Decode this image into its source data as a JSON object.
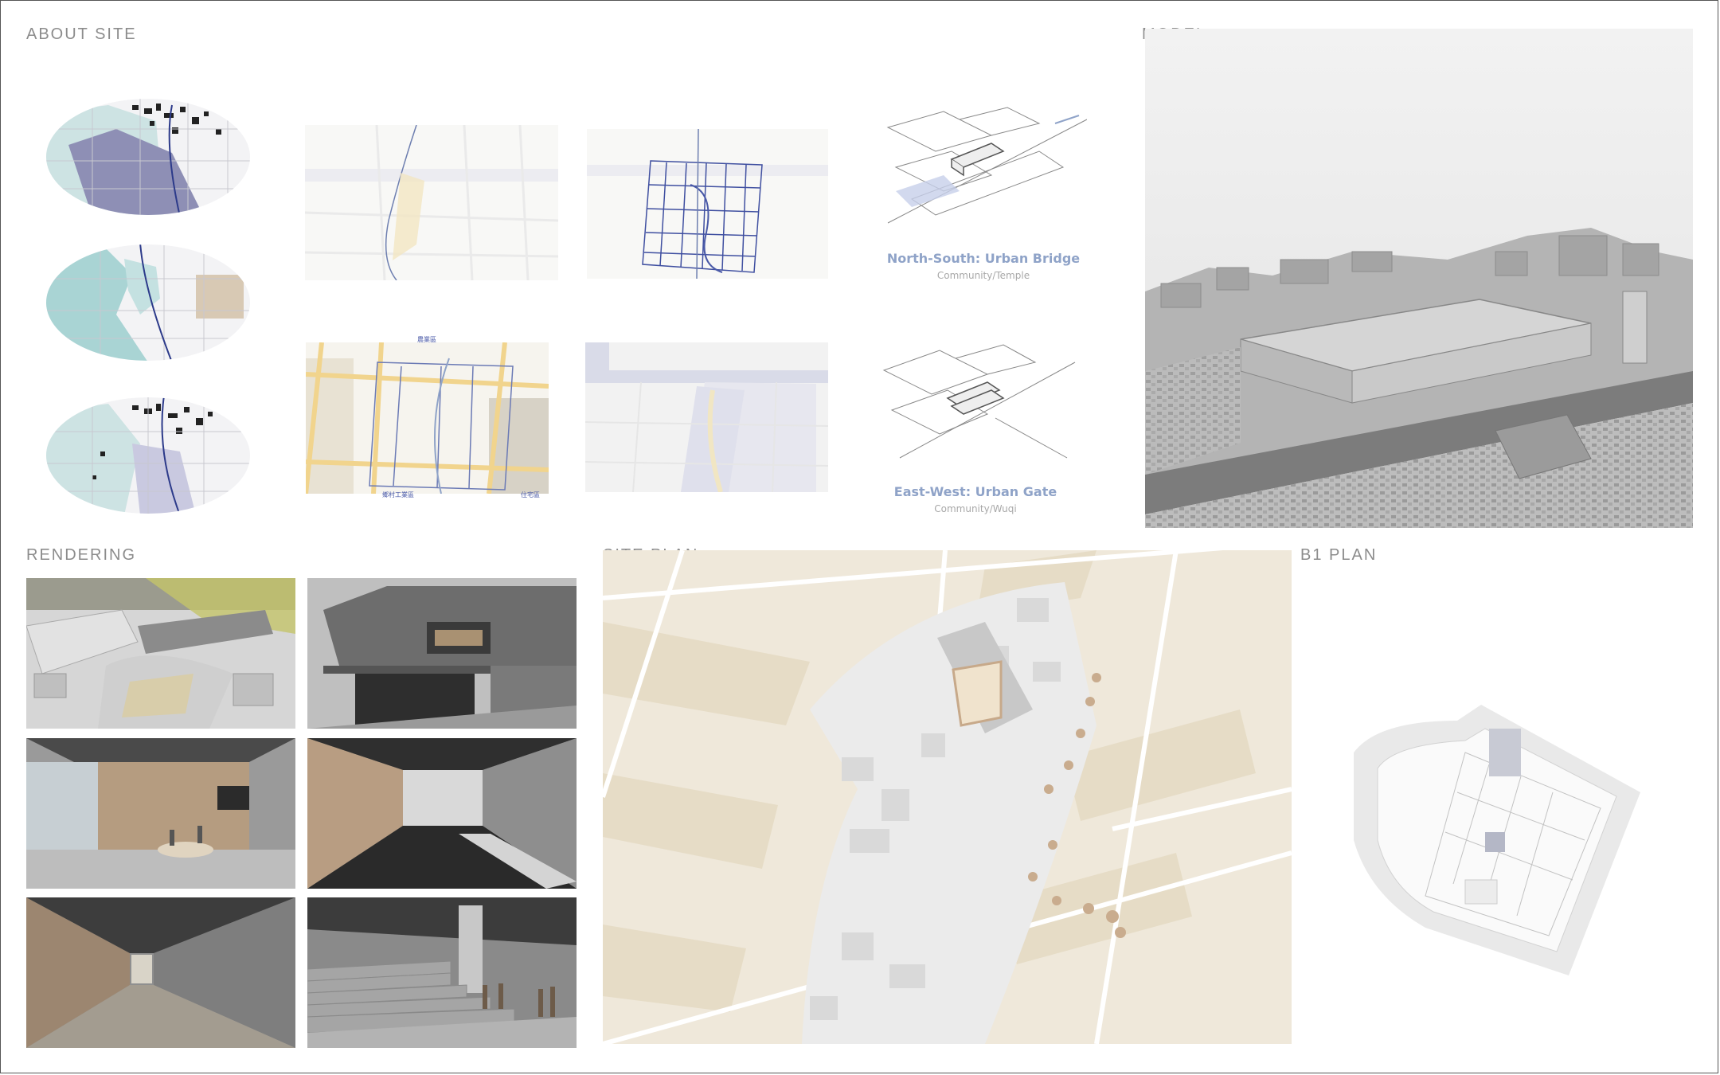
{
  "sections": {
    "about_site": "ABOUT SITE",
    "model": "MODEL",
    "rendering": "RENDERING",
    "site_plan": "SITE PLAN",
    "b1_plan": "B1 PLAN"
  },
  "diagrams": {
    "north_south": {
      "title": "North-South: Urban Bridge",
      "subtitle": "Community/Temple"
    },
    "east_west": {
      "title": "East-West: Urban Gate",
      "subtitle": "Community/Wuqi"
    }
  },
  "map_labels": {
    "top": "農業區",
    "bottom_left": "鄉村工業區",
    "bottom_right": "住宅區"
  },
  "colors": {
    "title_gray": "#8c8c8c",
    "caption_blue": "#8fa3c8",
    "sand": "#efe8da",
    "teal": "#a9d4d4",
    "purple": "#8f8fb3"
  }
}
